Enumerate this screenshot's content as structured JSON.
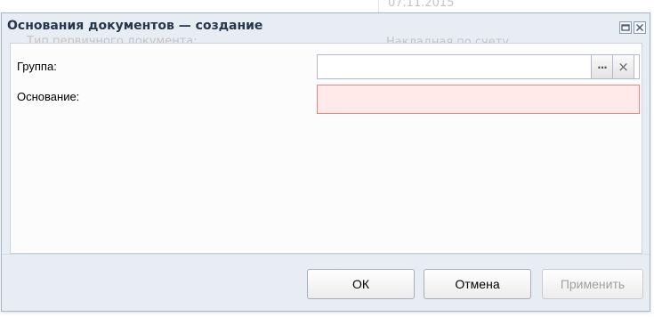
{
  "background": {
    "date_text": "07.11.2015",
    "doc_type_label": "Тип первичного документа:",
    "waybill_text": "Накладная по счету"
  },
  "dialog": {
    "title": "Основания документов — создание",
    "maximize_icon": "maximize-icon",
    "close_icon": "close-icon"
  },
  "form": {
    "group": {
      "label": "Группа:",
      "value": "",
      "picker_glyph": "...",
      "clear_glyph": "×"
    },
    "basis": {
      "label": "Основание:",
      "value": ""
    }
  },
  "buttons": {
    "ok": "ОК",
    "cancel": "Отмена",
    "apply": "Применить"
  },
  "colors": {
    "title": "#24374f",
    "dialog_bg": "#e8edf4",
    "invalid_border": "#e58686",
    "invalid_bg": "#ffe9e9"
  }
}
